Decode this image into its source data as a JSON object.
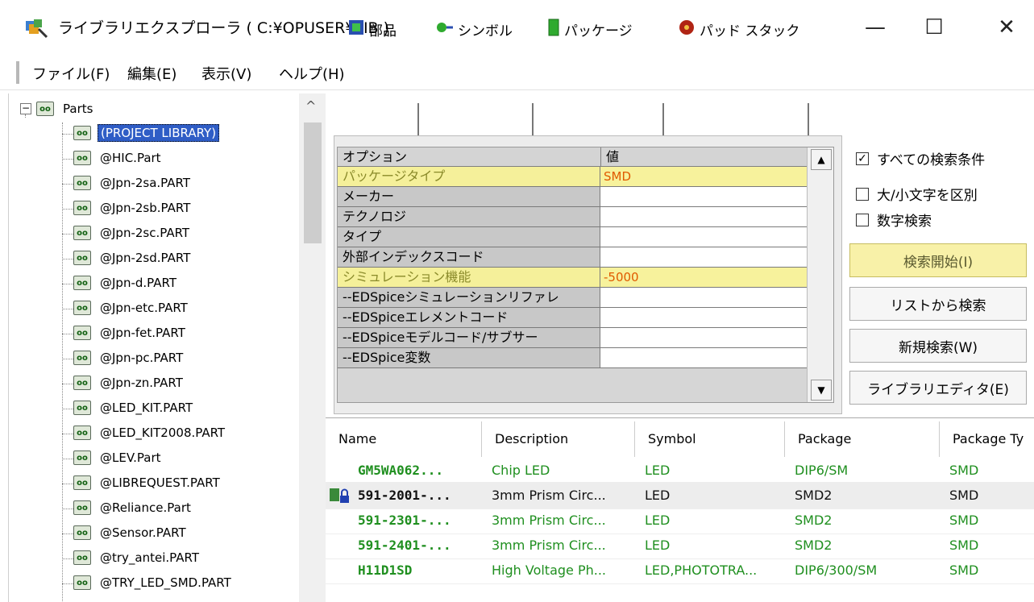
{
  "window": {
    "title": "ライブラリエクスプローラ ( C:¥OPUSER¥LIB )",
    "min_glyph": "—",
    "max_glyph": "☐",
    "close_glyph": "✕"
  },
  "menu": [
    "ファイル(F)",
    "編集(E)",
    "表示(V)",
    "ヘルプ(H)"
  ],
  "tree": {
    "root_label": "Parts",
    "expander": "−",
    "icon_text": "oo",
    "items": [
      "(PROJECT LIBRARY)",
      "@HIC.Part",
      "@Jpn-2sa.PART",
      "@Jpn-2sb.PART",
      "@Jpn-2sc.PART",
      "@Jpn-2sd.PART",
      "@Jpn-d.PART",
      "@Jpn-etc.PART",
      "@Jpn-fet.PART",
      "@Jpn-pc.PART",
      "@Jpn-zn.PART",
      "@LED_KIT.PART",
      "@LED_KIT2008.PART",
      "@LEV.Part",
      "@LIBREQUEST.PART",
      "@Reliance.Part",
      "@Sensor.PART",
      "@try_antei.PART",
      "@TRY_LED_SMD.PART"
    ]
  },
  "tabs": [
    {
      "label": "部品",
      "icon": "parts-icon"
    },
    {
      "label": "シンボル",
      "icon": "symbol-icon"
    },
    {
      "label": "パッケージ",
      "icon": "package-icon"
    },
    {
      "label": "パッド スタック",
      "icon": "padstack-icon"
    }
  ],
  "grid": {
    "header_option": "オプション",
    "header_value": "値",
    "rows": [
      {
        "name": "パッケージタイプ",
        "value": "SMD"
      },
      {
        "name": "メーカー",
        "value": ""
      },
      {
        "name": "テクノロジ",
        "value": ""
      },
      {
        "name": "タイプ",
        "value": ""
      },
      {
        "name": "外部インデックスコード",
        "value": ""
      },
      {
        "name": "シミュレーション機能",
        "value": "-5000"
      },
      {
        "name": "--EDSpiceシミュレーションリファレ",
        "value": ""
      },
      {
        "name": "--EDSpiceエレメントコード",
        "value": ""
      },
      {
        "name": "--EDSpiceモデルコード/サブサー",
        "value": ""
      },
      {
        "name": "--EDSpice変数",
        "value": ""
      }
    ]
  },
  "options": {
    "all_conditions": "すべての検索条件",
    "case_sensitive": "大/小文字を区別",
    "numeric_search": "数字検索",
    "check_mark": "✓"
  },
  "buttons": {
    "start_search": "検索開始(I)",
    "search_from_list": "リストから検索",
    "new_search": "新規検索(W)",
    "library_editor": "ライブラリエディタ(E)"
  },
  "list": {
    "columns": [
      "Name",
      "Description",
      "Symbol",
      "Package",
      "Package Ty"
    ],
    "rows": [
      {
        "name": "GM5WA062...",
        "description": "Chip LED",
        "symbol": "LED",
        "package": "DIP6/SM",
        "package_type": "SMD",
        "style": "green"
      },
      {
        "name": "591-2001-...",
        "description": "3mm Prism Circ...",
        "symbol": "LED",
        "package": "SMD2",
        "package_type": "SMD",
        "style": "black"
      },
      {
        "name": "591-2301-...",
        "description": "3mm Prism Circ...",
        "symbol": "LED",
        "package": "SMD2",
        "package_type": "SMD",
        "style": "green"
      },
      {
        "name": "591-2401-...",
        "description": "3mm Prism Circ...",
        "symbol": "LED",
        "package": "SMD2",
        "package_type": "SMD",
        "style": "green"
      },
      {
        "name": "H11D1SD",
        "description": "High Voltage Ph...",
        "symbol": "LED,PHOTOTRA...",
        "package": "DIP6/300/SM",
        "package_type": "SMD",
        "style": "green"
      }
    ]
  }
}
